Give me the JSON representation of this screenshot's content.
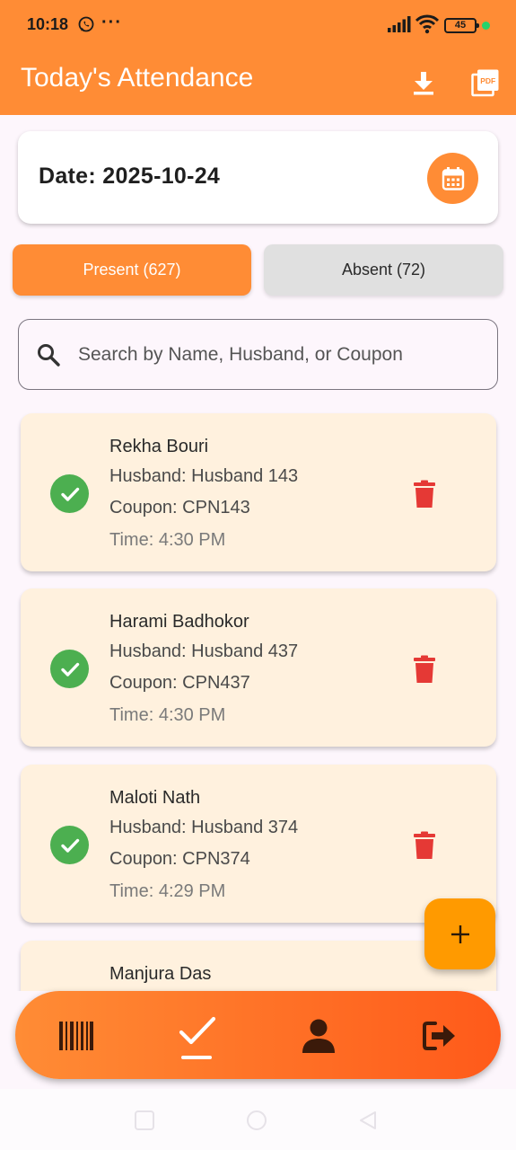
{
  "status_bar": {
    "time": "10:18",
    "dots": "···",
    "battery": "45",
    "colors": {
      "bar": "#ff8c35",
      "dot": "#27d36b"
    }
  },
  "app_bar": {
    "title": "Today's Attendance",
    "icons": [
      "download-icon",
      "pdf-icon"
    ]
  },
  "date_card": {
    "label": "Date: 2025-10-24",
    "icon": "calendar-icon"
  },
  "tabs": [
    {
      "label": "Present (627)",
      "active": true
    },
    {
      "label": "Absent (72)",
      "active": false
    }
  ],
  "search": {
    "placeholder": "Search by Name, Husband, or Coupon",
    "value": ""
  },
  "records": [
    {
      "name": "Rekha Bouri",
      "husband": "Husband: Husband 143",
      "coupon": "Coupon: CPN143",
      "time": "Time: 4:30 PM"
    },
    {
      "name": "Harami Badhokor",
      "husband": "Husband: Husband 437",
      "coupon": "Coupon: CPN437",
      "time": "Time: 4:30 PM"
    },
    {
      "name": "Maloti Nath",
      "husband": "Husband: Husband 374",
      "coupon": "Coupon: CPN374",
      "time": "Time: 4:29 PM"
    },
    {
      "name": "Manjura Das",
      "husband": "",
      "coupon": "",
      "time": ""
    }
  ],
  "fab": {
    "icon": "plus-icon",
    "color": "#ff9a00"
  },
  "bottom_nav": {
    "items": [
      "barcode-icon",
      "check-icon",
      "person-icon",
      "logout-icon"
    ],
    "active_index": 1,
    "gradient": [
      "#ff8c35",
      "#ff5a1a"
    ]
  },
  "colors": {
    "accent": "#ff8c35",
    "card_bg": "#fff1de",
    "present_check": "#4caf50",
    "delete": "#e53935"
  }
}
